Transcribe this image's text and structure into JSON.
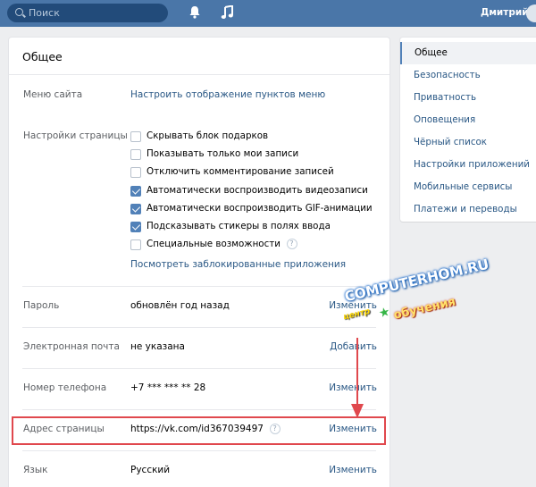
{
  "topbar": {
    "search_placeholder": "Поиск",
    "user_name": "Дмитрий",
    "icons": [
      "search-icon",
      "bell-icon",
      "music-icon"
    ]
  },
  "settings": {
    "title": "Общее",
    "site_menu": {
      "label": "Меню сайта",
      "link": "Настроить отображение пунктов меню"
    },
    "page_settings": {
      "label": "Настройки страницы",
      "options": [
        {
          "text": "Скрывать блок подарков",
          "checked": false
        },
        {
          "text": "Показывать только мои записи",
          "checked": false
        },
        {
          "text": "Отключить комментирование записей",
          "checked": false
        },
        {
          "text": "Автоматически воспроизводить видеозаписи",
          "checked": true
        },
        {
          "text": "Автоматически воспроизводить GIF-анимации",
          "checked": true
        },
        {
          "text": "Подсказывать стикеры в полях ввода",
          "checked": true
        },
        {
          "text": "Специальные возможности",
          "checked": false
        }
      ],
      "help": "?",
      "blocked_apps_link": "Посмотреть заблокированные приложения"
    },
    "password": {
      "label": "Пароль",
      "value": "обновлён год назад",
      "action": "Изменить"
    },
    "email": {
      "label": "Электронная почта",
      "value": "не указана",
      "action": "Добавить"
    },
    "phone": {
      "label": "Номер телефона",
      "value": "+7 *** *** ** 28",
      "action": "Изменить"
    },
    "address": {
      "label": "Адрес страницы",
      "value": "https://vk.com/id367039497",
      "help": "?",
      "action": "Изменить"
    },
    "language": {
      "label": "Язык",
      "value": "Русский",
      "action": "Изменить"
    }
  },
  "side_menu": {
    "items": [
      {
        "label": "Общее",
        "active": true
      },
      {
        "label": "Безопасность",
        "active": false
      },
      {
        "label": "Приватность",
        "active": false
      },
      {
        "label": "Оповещения",
        "active": false
      },
      {
        "label": "Чёрный список",
        "active": false
      },
      {
        "label": "Настройки приложений",
        "active": false
      },
      {
        "label": "Мобильные сервисы",
        "active": false
      },
      {
        "label": "Платежи и переводы",
        "active": false
      }
    ]
  },
  "watermark": {
    "line1": "COMPUTERHOM.RU",
    "line2": "центр",
    "line3": "обучения"
  },
  "colors": {
    "header": "#4a76a8",
    "link": "#2a5885",
    "accent": "#5181b8",
    "highlight": "#e0484d"
  }
}
